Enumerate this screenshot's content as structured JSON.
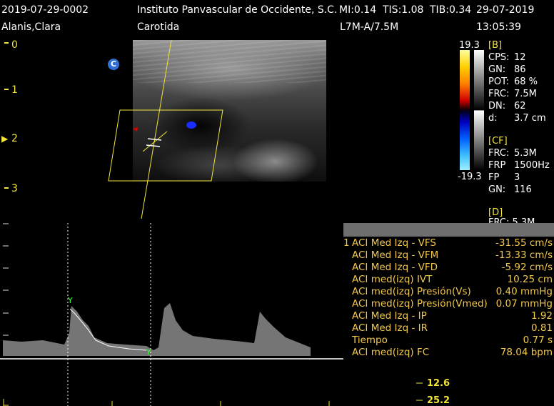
{
  "header": {
    "patient_id": "2019-07-29-0002",
    "institution": "Instituto Panvascular de Occidente, S.C.",
    "mi": "MI:0.14",
    "tis": "TIS:1.08",
    "tib": "TIB:0.34",
    "date": "29-07-2019",
    "patient_name": "Alanis,Clara",
    "exam": "Carotida",
    "probe": "L7M-A/7.5M",
    "time": "13:05:39"
  },
  "depth_scale": [
    "0",
    "1",
    "2",
    "3"
  ],
  "orientation_marker": "C",
  "color_scale": {
    "max": "19.3",
    "min": "-19.3"
  },
  "b_params": {
    "title": "[B]",
    "rows": [
      {
        "label": "CPS:",
        "value": "12"
      },
      {
        "label": "GN:",
        "value": "86"
      },
      {
        "label": "POT:",
        "value": "68 %"
      },
      {
        "label": "FRC:",
        "value": "7.5M"
      },
      {
        "label": "DN:",
        "value": "62"
      },
      {
        "label": "d:",
        "value": "3.7 cm"
      }
    ]
  },
  "cf_params": {
    "title": "[CF]",
    "rows": [
      {
        "label": "FRC:",
        "value": "5.3M"
      },
      {
        "label": "FRP",
        "value": "1500Hz"
      },
      {
        "label": "FP",
        "value": "3"
      },
      {
        "label": "GN:",
        "value": "116"
      }
    ]
  },
  "d_params": {
    "title": "[D]",
    "partial": "FRC: 5.3M"
  },
  "measurements": {
    "rows": [
      {
        "num": "1",
        "label": "ACI Med Izq - VFS",
        "value": "-31.55 cm/s"
      },
      {
        "num": "",
        "label": "ACI Med Izq - VFM",
        "value": "-13.33 cm/s"
      },
      {
        "num": "",
        "label": "ACI Med Izq - VFD",
        "value": "-5.92 cm/s"
      },
      {
        "num": "",
        "label": "ACI med(izq) IVT",
        "value": "10.25 cm"
      },
      {
        "num": "",
        "label": "ACI med(izq) Presión(Vs)",
        "value": "0.40 mmHg"
      },
      {
        "num": "",
        "label": "ACI med(izq) Presión(Vmed)",
        "value": "0.07 mmHg"
      },
      {
        "num": "",
        "label": "ACI Med Izq - IP",
        "value": "1.92"
      },
      {
        "num": "",
        "label": "ACI Med Izq - IR",
        "value": "0.81"
      },
      {
        "num": "",
        "label": "Tiempo",
        "value": "0.77 s"
      },
      {
        "num": "",
        "label": "ACI med(izq) FC",
        "value": "78.04 bpm"
      }
    ]
  },
  "velocity_scale": [
    "12.6",
    "25.2"
  ],
  "colors": {
    "scale_yellow": "#f2e53a",
    "measurement_orange": "#f2c84b",
    "caliper_green": "#3cff3c",
    "marker_blue": "#2f6fd6"
  }
}
